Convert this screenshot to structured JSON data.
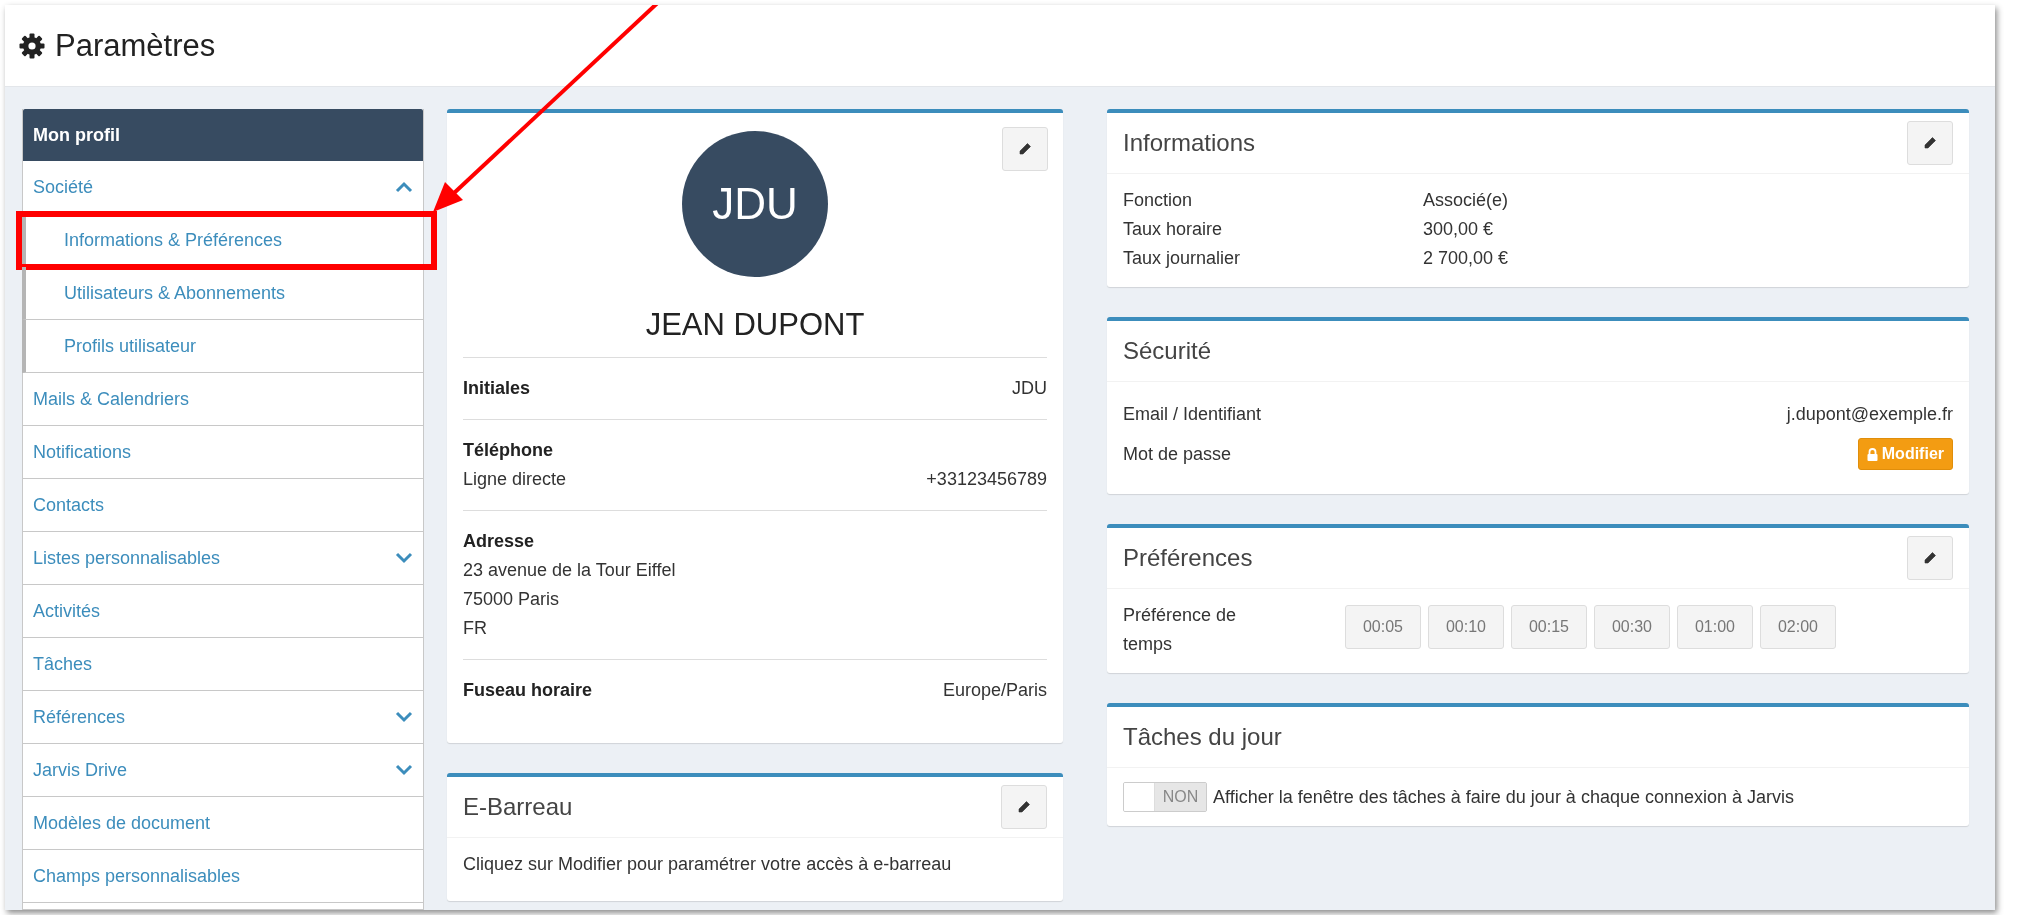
{
  "header": {
    "title": "Paramètres"
  },
  "sidebar": {
    "title": "Mon profil",
    "items": [
      {
        "kind": "group",
        "label": "Société",
        "expanded": true,
        "children": [
          {
            "label": "Informations & Préférences",
            "highlighted": true
          },
          {
            "label": "Utilisateurs & Abonnements",
            "highlighted": false
          },
          {
            "label": "Profils utilisateur",
            "highlighted": false
          }
        ]
      },
      {
        "kind": "link",
        "label": "Mails & Calendriers"
      },
      {
        "kind": "link",
        "label": "Notifications"
      },
      {
        "kind": "link",
        "label": "Contacts"
      },
      {
        "kind": "group",
        "label": "Listes personnalisables",
        "expanded": false
      },
      {
        "kind": "link",
        "label": "Activités"
      },
      {
        "kind": "link",
        "label": "Tâches"
      },
      {
        "kind": "group",
        "label": "Références",
        "expanded": false
      },
      {
        "kind": "group",
        "label": "Jarvis Drive",
        "expanded": false
      },
      {
        "kind": "link",
        "label": "Modèles de document"
      },
      {
        "kind": "link",
        "label": "Champs personnalisables"
      }
    ]
  },
  "profile": {
    "editable": true,
    "avatar": "JDU",
    "name": "JEAN DUPONT",
    "fields": [
      {
        "kind": "inline",
        "label": "Initiales",
        "value": "JDU"
      },
      {
        "kind": "sub",
        "label": "Téléphone",
        "sublabel": "Ligne directe",
        "value": "+33123456789"
      },
      {
        "kind": "block",
        "label": "Adresse",
        "lines": [
          "23 avenue de la Tour Eiffel",
          "75000 Paris",
          "FR"
        ]
      },
      {
        "kind": "inline",
        "label": "Fuseau horaire",
        "value": "Europe/Paris"
      }
    ]
  },
  "ebarreau": {
    "title": "E-Barreau",
    "editable": true,
    "text": "Cliquez sur Modifier pour paramétrer votre accès à e-barreau"
  },
  "informations": {
    "title": "Informations",
    "editable": true,
    "rows": [
      {
        "label": "Fonction",
        "value": "Associé(e)"
      },
      {
        "label": "Taux horaire",
        "value": "300,00 €"
      },
      {
        "label": "Taux journalier",
        "value": "2 700,00 €"
      }
    ]
  },
  "securite": {
    "title": "Sécurité",
    "editable": false,
    "rows": [
      {
        "kind": "text",
        "label": "Email / Identifiant",
        "value": "j.dupont@exemple.fr"
      },
      {
        "kind": "button",
        "label": "Mot de passe",
        "value": "Modifier"
      }
    ]
  },
  "preferences": {
    "title": "Préférences",
    "editable": true,
    "label": "Préférence de temps",
    "options": [
      {
        "label": "00:05",
        "selected": false
      },
      {
        "label": "00:10",
        "selected": false
      },
      {
        "label": "00:15",
        "selected": false
      },
      {
        "label": "00:30",
        "selected": false
      },
      {
        "label": "01:00",
        "selected": false
      },
      {
        "label": "02:00",
        "selected": false
      }
    ]
  },
  "taches": {
    "title": "Tâches du jour",
    "editable": false,
    "toggle": {
      "on": false,
      "label": "NON"
    },
    "text": "Afficher la fenêtre des tâches à faire du jour à chaque connexion à Jarvis"
  }
}
